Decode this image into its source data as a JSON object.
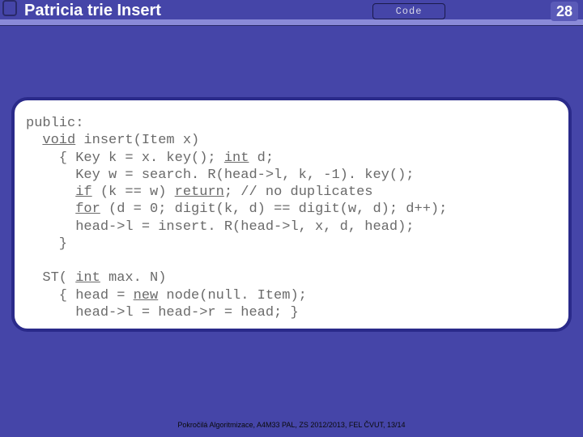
{
  "header": {
    "title": "Patricia trie Insert",
    "badge": "Code",
    "page_number": "28"
  },
  "code": {
    "l1": "public:",
    "l2a": "  ",
    "l2kw": "void",
    "l2b": " insert(Item x)",
    "l3a": "    { Key k = x. key(); ",
    "l3kw": "int",
    "l3b": " d;",
    "l4": "      Key w = search. R(head->l, k, -1). key();",
    "l5a": "      ",
    "l5kw1": "if",
    "l5b": " (k == w) ",
    "l5kw2": "return",
    "l5c": "; ",
    "l5cmt": "// no duplicates",
    "l6a": "      ",
    "l6kw": "for",
    "l6b": " (d = 0; digit(k, d) == digit(w, d); d++);",
    "l7": "      head->l = insert. R(head->l, x, d, head);",
    "l8": "    }",
    "blank": "",
    "l9a": "  ST( ",
    "l9kw": "int",
    "l9b": " max. N)",
    "l10a": "    { head = ",
    "l10kw": "new",
    "l10b": " node(null. Item);",
    "l11": "      head->l = head->r = head; }"
  },
  "footer": {
    "text": "Pokročilá Algoritmizace, A4M33 PAL, ZS 2012/2013, FEL ČVUT, 13/14"
  }
}
